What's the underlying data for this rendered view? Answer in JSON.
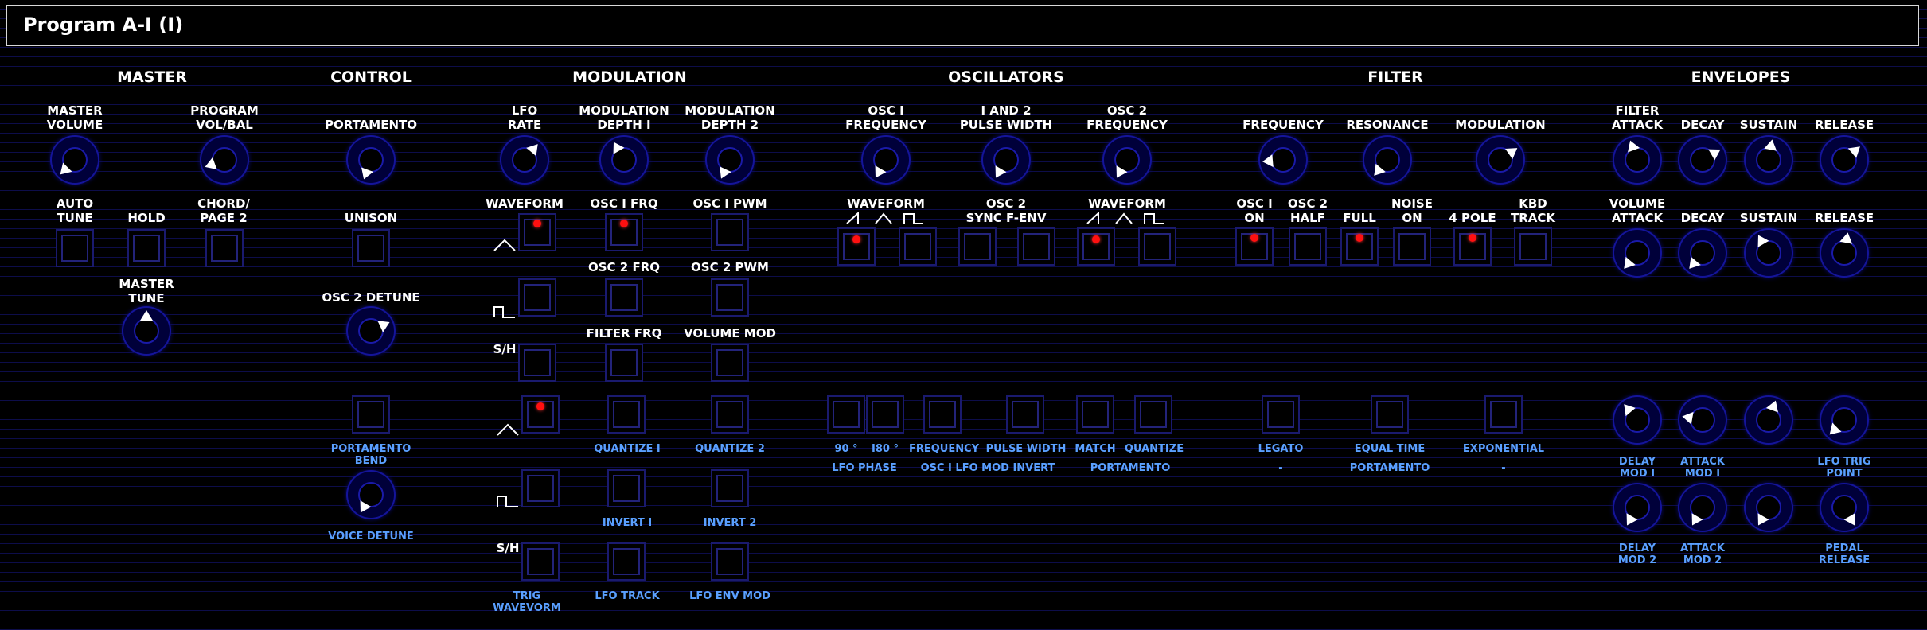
{
  "program_title": "Program A-I (I)",
  "sections": {
    "master": "MASTER",
    "control": "CONTROL",
    "modulation": "MODULATION",
    "oscillators": "OSCILLATORS",
    "filter": "FILTER",
    "envelopes": "ENVELOPES"
  },
  "master": {
    "master_volume": "MASTER\nVOLUME",
    "program_vol_bal": "PROGRAM\nVOL/BAL",
    "auto_tune": "AUTO\nTUNE",
    "hold": "HOLD",
    "chord_page2": "CHORD/\nPAGE 2",
    "master_tune": "MASTER\nTUNE"
  },
  "control": {
    "portamento": "PORTAMENTO",
    "unison": "UNISON",
    "osc2_detune": "OSC 2 DETUNE",
    "portamento_bend": "PORTAMENTO\nBEND",
    "voice_detune": "VOICE DETUNE"
  },
  "modulation": {
    "lfo_rate": "LFO\nRATE",
    "mod_depth1": "MODULATION\nDEPTH I",
    "mod_depth2": "MODULATION\nDEPTH 2",
    "waveform": "WAVEFORM",
    "osc1_frq": "OSC I FRQ",
    "osc1_pwm": "OSC I PWM",
    "osc2_frq": "OSC 2 FRQ",
    "osc2_pwm": "OSC 2 PWM",
    "sh1": "S/H",
    "filter_frq": "FILTER FRQ",
    "volume_mod": "VOLUME MOD",
    "quantize1": "QUANTIZE I",
    "quantize2": "QUANTIZE 2",
    "invert1": "INVERT I",
    "invert2": "INVERT 2",
    "sh2": "S/H",
    "trig_waveform": "TRIG\nWAVEVORM",
    "lfo_track": "LFO TRACK",
    "lfo_env_mod": "LFO ENV MOD"
  },
  "oscillators": {
    "osc1_frequency": "OSC I\nFREQUENCY",
    "pulse_width": "I AND 2\nPULSE WIDTH",
    "osc2_frequency": "OSC 2\nFREQUENCY",
    "waveform1": "WAVEFORM",
    "osc2_sync": "OSC 2\nSYNC F-ENV",
    "waveform2": "WAVEFORM",
    "phase_90": "90 °",
    "phase_180": "I80 °",
    "frequency": "FREQUENCY",
    "pulse_width_low": "PULSE WIDTH",
    "match": "MATCH",
    "quantize": "QUANTIZE",
    "lfo_phase": "LFO PHASE",
    "osc1_lfo_mod_invert": "OSC I LFO MOD INVERT",
    "portamento": "PORTAMENTO"
  },
  "filter": {
    "frequency": "FREQUENCY",
    "resonance": "RESONANCE",
    "modulation": "MODULATION",
    "osc1_on": "OSC I\nON",
    "osc2_half": "OSC 2\nHALF",
    "full": "FULL",
    "noise_on": "NOISE\nON",
    "four_pole": "4 POLE",
    "kbd_track": "KBD\nTRACK",
    "legato": "LEGATO",
    "equal_time": "EQUAL TIME",
    "exponential": "EXPONENTIAL",
    "dash1": "-",
    "portamento": "PORTAMENTO",
    "dash2": "-"
  },
  "envelopes": {
    "filter_attack": "FILTER\nATTACK",
    "decay": "DECAY",
    "sustain": "SUSTAIN",
    "release": "RELEASE",
    "volume_attack": "VOLUME\nATTACK",
    "decay2": "DECAY",
    "sustain2": "SUSTAIN",
    "release2": "RELEASE",
    "delay_mod1": "DELAY\nMOD I",
    "attack_mod1": "ATTACK\nMOD I",
    "lfo_trig_point": "LFO TRIG\nPOINT",
    "delay_mod2": "DELAY\nMOD 2",
    "attack_mod2": "ATTACK\nMOD 2",
    "pedal_release": "PEDAL\nRELEASE"
  },
  "colors": {
    "background": "#000000",
    "gridline": "#0d0d4a",
    "knob_ring": "#14149a",
    "led_on": "#ff1010",
    "blue_label": "#5aa0ff"
  }
}
